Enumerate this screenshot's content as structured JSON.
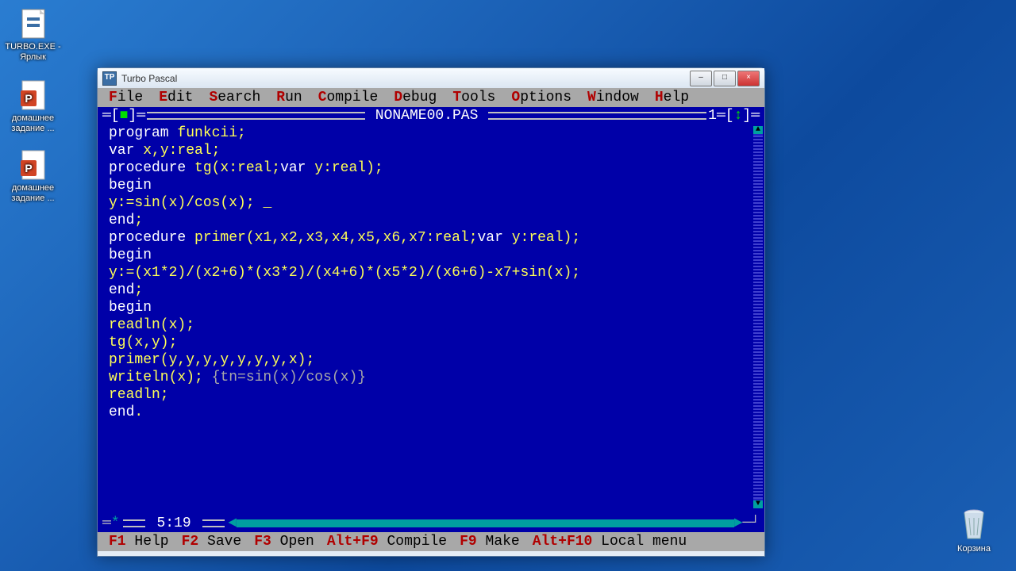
{
  "desktop": {
    "icons": [
      {
        "label": "TURBO.EXE - Ярлык",
        "icon": "exe"
      },
      {
        "label": "домашнее задание ...",
        "icon": "ppt"
      },
      {
        "label": "домашнее задание ...",
        "icon": "ppt"
      }
    ],
    "recycle": "Корзина"
  },
  "window": {
    "title": "Turbo Pascal",
    "controls": {
      "min": "–",
      "max": "□",
      "close": "×"
    }
  },
  "menu": [
    "File",
    "Edit",
    "Search",
    "Run",
    "Compile",
    "Debug",
    "Tools",
    "Options",
    "Window",
    "Help"
  ],
  "titlebar": {
    "filename": "NONAME00.PAS",
    "window_num": "1"
  },
  "code": [
    {
      "segs": [
        {
          "t": "program ",
          "c": "kw"
        },
        {
          "t": "funkcii;",
          "c": "id"
        }
      ]
    },
    {
      "segs": [
        {
          "t": "var ",
          "c": "kw"
        },
        {
          "t": "x,y:real;",
          "c": "id"
        }
      ]
    },
    {
      "segs": [
        {
          "t": "procedure ",
          "c": "kw"
        },
        {
          "t": "tg(x:real;",
          "c": "id"
        },
        {
          "t": "var ",
          "c": "kw"
        },
        {
          "t": "y:real);",
          "c": "id"
        }
      ]
    },
    {
      "segs": [
        {
          "t": "begin",
          "c": "kw"
        }
      ]
    },
    {
      "segs": [
        {
          "t": "y:=sin(x)/cos(x); ",
          "c": "id"
        },
        {
          "t": "_",
          "c": "cursor"
        }
      ]
    },
    {
      "segs": [
        {
          "t": "end",
          "c": "kw"
        },
        {
          "t": ";",
          "c": "id"
        }
      ]
    },
    {
      "segs": [
        {
          "t": "procedure ",
          "c": "kw"
        },
        {
          "t": "primer(x1,x2,x3,x4,x5,x6,x7:real;",
          "c": "id"
        },
        {
          "t": "var ",
          "c": "kw"
        },
        {
          "t": "y:real);",
          "c": "id"
        }
      ]
    },
    {
      "segs": [
        {
          "t": "begin",
          "c": "kw"
        }
      ]
    },
    {
      "segs": [
        {
          "t": "y:=(x1*2)/(x2+6)*(x3*2)/(x4+6)*(x5*2)/(x6+6)-x7+sin(x);",
          "c": "id"
        }
      ]
    },
    {
      "segs": [
        {
          "t": "end",
          "c": "kw"
        },
        {
          "t": ";",
          "c": "id"
        }
      ]
    },
    {
      "segs": [
        {
          "t": "begin",
          "c": "kw"
        }
      ]
    },
    {
      "segs": [
        {
          "t": "readln(x);",
          "c": "id"
        }
      ]
    },
    {
      "segs": [
        {
          "t": "tg(x,y);",
          "c": "id"
        }
      ]
    },
    {
      "segs": [
        {
          "t": "primer(y,y,y,y,y,y,y,x);",
          "c": "id"
        }
      ]
    },
    {
      "segs": [
        {
          "t": "writeln(x); ",
          "c": "id"
        },
        {
          "t": "{tn=sin(x)/cos(x)}",
          "c": "cm"
        }
      ]
    },
    {
      "segs": [
        {
          "t": "readln;",
          "c": "id"
        }
      ]
    },
    {
      "segs": [
        {
          "t": "end",
          "c": "kw"
        },
        {
          "t": ".",
          "c": "id"
        }
      ]
    }
  ],
  "status_pos": "5:19",
  "fkeys": [
    {
      "k": "F1",
      "t": "Help"
    },
    {
      "k": "F2",
      "t": "Save"
    },
    {
      "k": "F3",
      "t": "Open"
    },
    {
      "k": "Alt+F9",
      "t": "Compile"
    },
    {
      "k": "F9",
      "t": "Make"
    },
    {
      "k": "Alt+F10",
      "t": "Local menu"
    }
  ]
}
